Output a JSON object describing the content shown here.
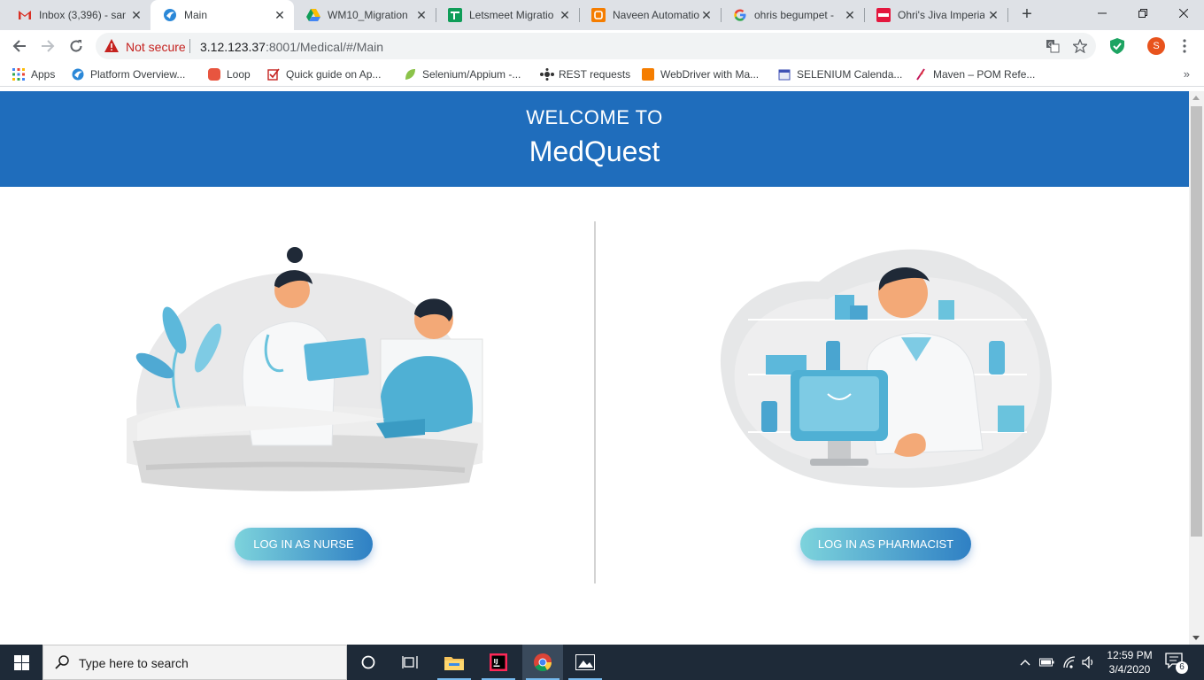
{
  "tabs": [
    {
      "title": "Inbox (3,396) - san",
      "icon": "gmail-icon",
      "active": false
    },
    {
      "title": "Main",
      "icon": "app-favicon-icon",
      "active": true
    },
    {
      "title": "WM10_Migration",
      "icon": "google-drive-icon",
      "active": false
    },
    {
      "title": "Letsmeet Migratio",
      "icon": "google-sheets-icon",
      "active": false
    },
    {
      "title": "Naveen Automatio",
      "icon": "blogger-icon",
      "active": false
    },
    {
      "title": "ohris begumpet -",
      "icon": "google-icon",
      "active": false
    },
    {
      "title": "Ohri's Jiva Imperia",
      "icon": "site-favicon-icon",
      "active": false
    }
  ],
  "address_bar": {
    "security_text": "Not secure",
    "url_host": "3.12.123.37",
    "url_rest": ":8001/Medical/#/Main"
  },
  "profile_initial": "S",
  "bookmarks": [
    {
      "label": "Apps"
    },
    {
      "label": "Platform Overview..."
    },
    {
      "label": "Loop"
    },
    {
      "label": "Quick guide on Ap..."
    },
    {
      "label": "Selenium/Appium -..."
    },
    {
      "label": "REST requests"
    },
    {
      "label": "WebDriver with Ma..."
    },
    {
      "label": "SELENIUM Calenda..."
    },
    {
      "label": "Maven – POM Refe..."
    }
  ],
  "page": {
    "welcome": "WELCOME TO",
    "brand": "MedQuest",
    "nurse_button": "LOG IN AS NURSE",
    "pharmacist_button": "LOG IN AS PHARMACIST"
  },
  "taskbar": {
    "search_placeholder": "Type here to search",
    "time": "12:59 PM",
    "date": "3/4/2020",
    "notification_count": "6"
  },
  "colors": {
    "banner": "#1f6dbc",
    "button_gradient_start": "#7dd3dc",
    "button_gradient_end": "#2f80c4",
    "taskbar": "#1e2a38"
  }
}
